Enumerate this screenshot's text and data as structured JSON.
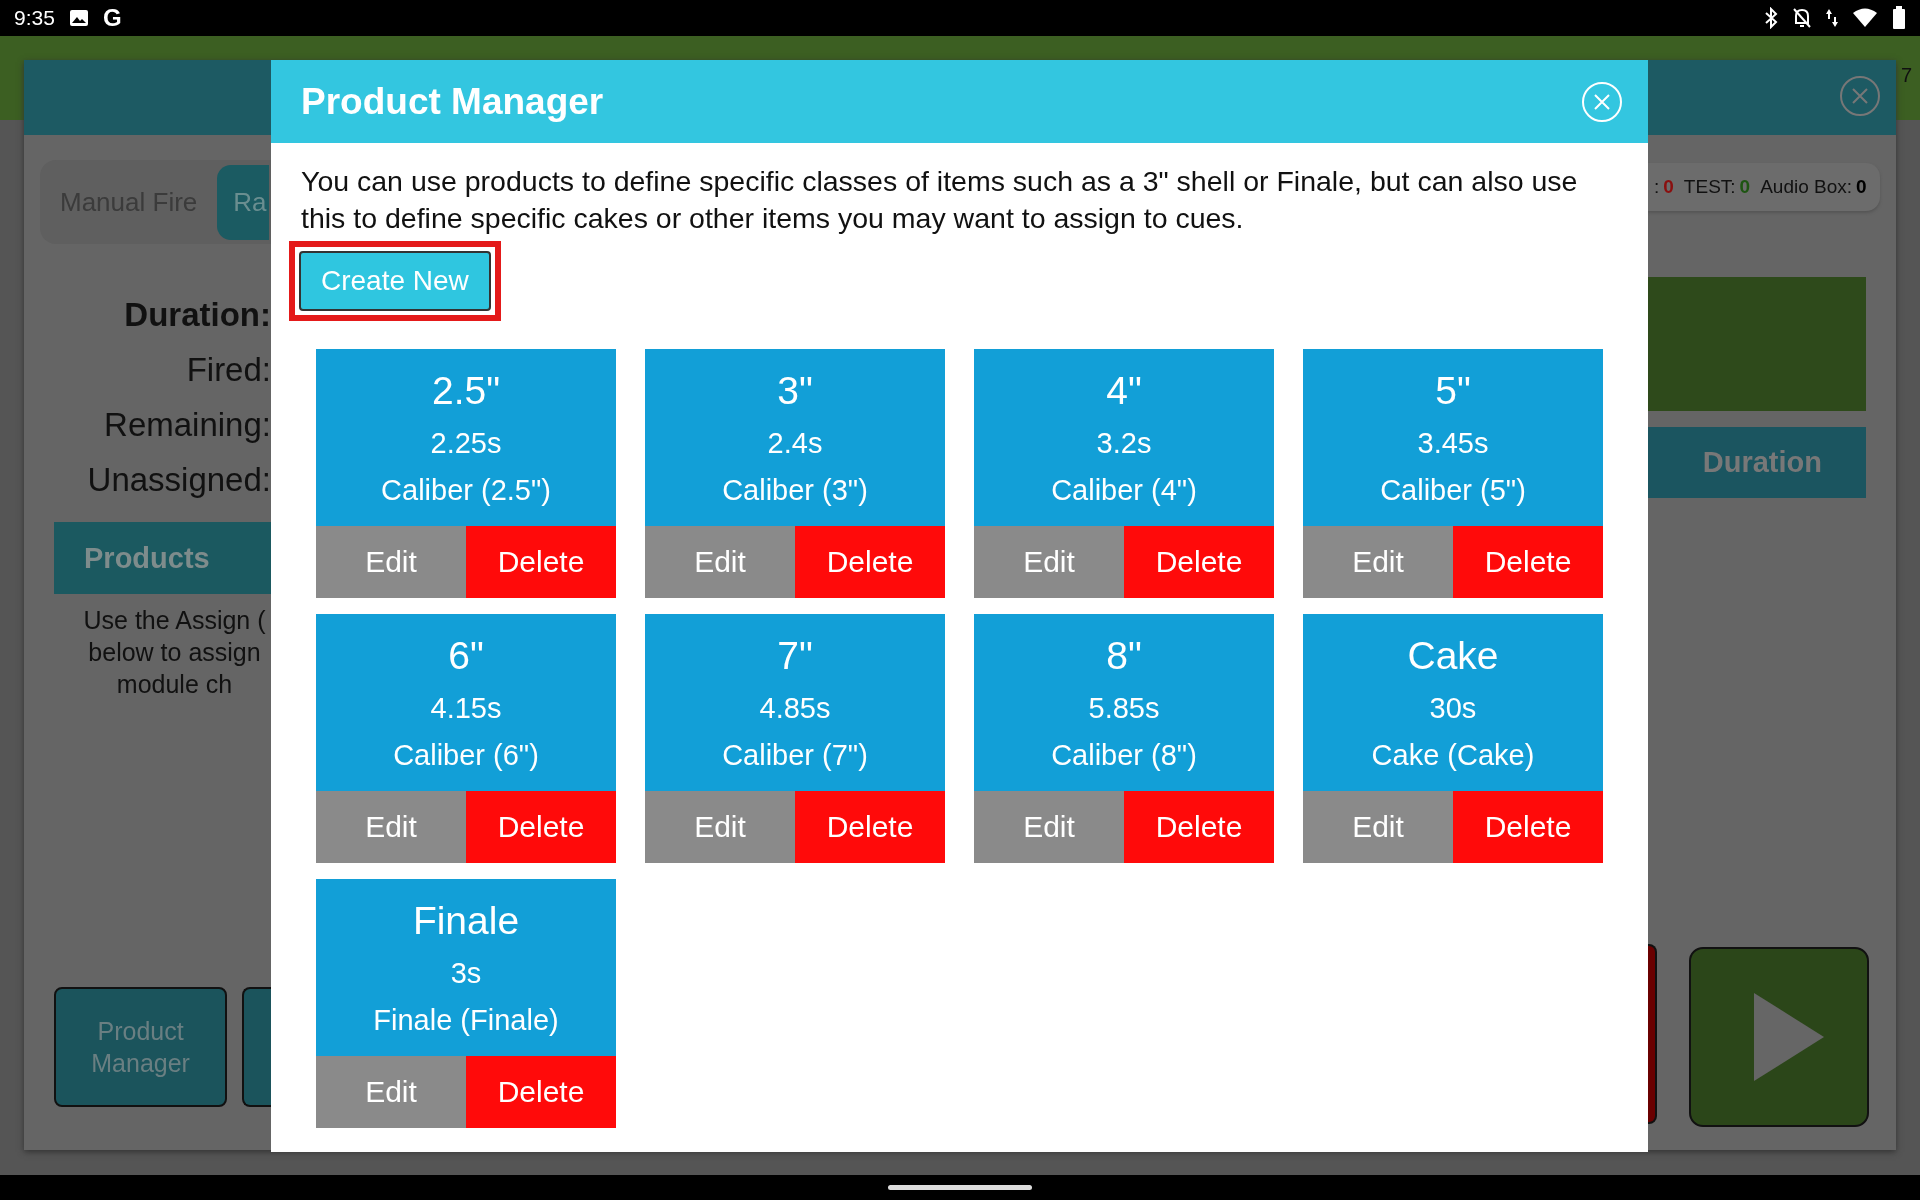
{
  "status_bar": {
    "time": "9:35",
    "logo": "G"
  },
  "background": {
    "top_bar_badge": "7",
    "mode_tabs": [
      {
        "label": "Manual Fire",
        "selected": false
      },
      {
        "label": "Ra",
        "selected": true
      }
    ],
    "stats": [
      {
        "label": "Duration:",
        "bold": true
      },
      {
        "label": "Fired:",
        "bold": false
      },
      {
        "label": "Remaining:",
        "bold": false
      },
      {
        "label": "Unassigned:",
        "bold": false
      }
    ],
    "products_header": "Products",
    "products_hint": [
      "Use the Assign (",
      "below to assign",
      "module ch"
    ],
    "counters": [
      {
        "label": ":",
        "value": "0",
        "color": "#8a0f0f"
      },
      {
        "label": "TEST:",
        "value": "0",
        "color": "#1e5512"
      },
      {
        "label": "Audio Box:",
        "value": "0",
        "color": "#000000"
      }
    ],
    "duration_button": "Duration",
    "product_manager_button": "Product Manager"
  },
  "dialog": {
    "title": "Product Manager",
    "description": "You can use products to define specific classes of items such as a 3\" shell or Finale, but can also use this to define specific cakes or other items you may want to assign to cues.",
    "create_button": {
      "label": "Create New",
      "highlighted": true
    },
    "products": [
      {
        "name": "2.5\"",
        "duration": "2.25s",
        "type": "Caliber (2.5\")",
        "edit": "Edit",
        "delete": "Delete"
      },
      {
        "name": "3\"",
        "duration": "2.4s",
        "type": "Caliber (3\")",
        "edit": "Edit",
        "delete": "Delete"
      },
      {
        "name": "4\"",
        "duration": "3.2s",
        "type": "Caliber (4\")",
        "edit": "Edit",
        "delete": "Delete"
      },
      {
        "name": "5\"",
        "duration": "3.45s",
        "type": "Caliber (5\")",
        "edit": "Edit",
        "delete": "Delete"
      },
      {
        "name": "6\"",
        "duration": "4.15s",
        "type": "Caliber (6\")",
        "edit": "Edit",
        "delete": "Delete"
      },
      {
        "name": "7\"",
        "duration": "4.85s",
        "type": "Caliber (7\")",
        "edit": "Edit",
        "delete": "Delete"
      },
      {
        "name": "8\"",
        "duration": "5.85s",
        "type": "Caliber (8\")",
        "edit": "Edit",
        "delete": "Delete"
      },
      {
        "name": "Cake",
        "duration": "30s",
        "type": "Cake (Cake)",
        "edit": "Edit",
        "delete": "Delete"
      },
      {
        "name": "Finale",
        "duration": "3s",
        "type": "Finale (Finale)",
        "edit": "Edit",
        "delete": "Delete"
      }
    ]
  }
}
